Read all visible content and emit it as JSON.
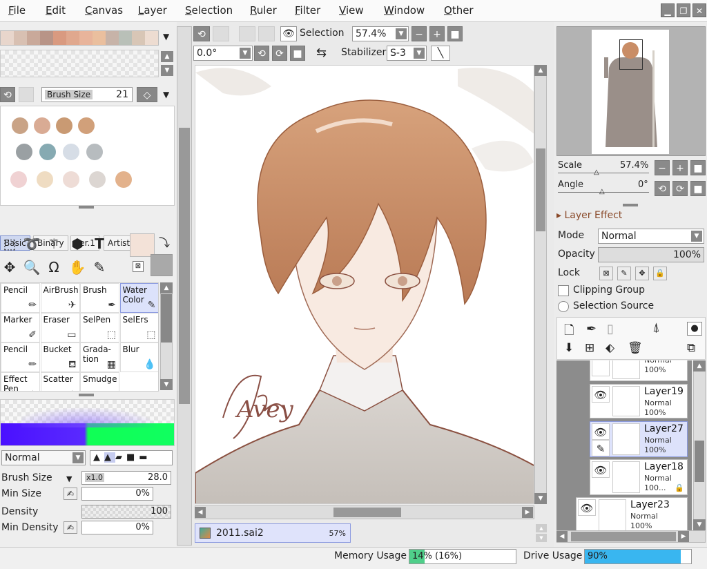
{
  "menu": {
    "items": [
      "File",
      "Edit",
      "Canvas",
      "Layer",
      "Selection",
      "Ruler",
      "Filter",
      "View",
      "Window",
      "Other"
    ]
  },
  "window_buttons": {
    "minimize": "▁",
    "restore": "❐",
    "close": "✕"
  },
  "brush_size_field": {
    "label": "Brush Size",
    "value": "21"
  },
  "swatch_colors": [
    "#c9a386",
    "#d9ab94",
    "#c99a73",
    "#d1a07a",
    "#9aa0a3",
    "#86aab2",
    "#d6dde6",
    "#b7bcbf",
    "#f0d2d3",
    "#efdcc2",
    "#eedcd6",
    "#dcd6d2",
    "#e3b28c"
  ],
  "palette_strip": [
    "#e8d6cc",
    "#d8c0b2",
    "#c9a99a",
    "#b89487",
    "#d99a80",
    "#e0a88e",
    "#e8b49b",
    "#eabf9e",
    "#c7b3a8",
    "#b9c0b8",
    "#d8c6b6",
    "#eddcd1"
  ],
  "tabs": [
    "Basic",
    "Binary",
    "Ver.1",
    "Artistic"
  ],
  "colors": {
    "fg": "#f3e2d8",
    "bg": "#a9a9a9",
    "accent": "#7b8fd0"
  },
  "brushes": [
    {
      "label": "Pencil"
    },
    {
      "label": "AirBrush"
    },
    {
      "label": "Brush"
    },
    {
      "label": "Water Color"
    },
    {
      "label": "Marker"
    },
    {
      "label": "Eraser"
    },
    {
      "label": "SelPen"
    },
    {
      "label": "SelErs"
    },
    {
      "label": "Pencil"
    },
    {
      "label": "Bucket"
    },
    {
      "label": "Grada- tion"
    },
    {
      "label": "Blur"
    },
    {
      "label": "Effect Pen"
    },
    {
      "label": "Scatter"
    },
    {
      "label": "Smudge"
    }
  ],
  "blend_mode": "Normal",
  "brush_settings": {
    "brush_size_label": "Brush Size",
    "brush_size_mult": "x1.0",
    "brush_size_value": "28.0",
    "min_size_label": "Min Size",
    "min_size_value": "0%",
    "density_label": "Density",
    "density_value": "100",
    "min_density_label": "Min Density",
    "min_density_value": "0%"
  },
  "canvas_toolbar": {
    "selection_label": "Selection",
    "zoom": "57.4%",
    "angle": "0.0°",
    "stabilizer_label": "Stabilizer",
    "stabilizer": "S-3"
  },
  "canvas": {
    "signature": "Avey"
  },
  "document_tab": {
    "name": "2011.sai2",
    "zoom": "57%"
  },
  "navigator": {
    "scale_label": "Scale",
    "scale": "57.4%",
    "angle_label": "Angle",
    "angle": "0°"
  },
  "layer_effect": {
    "title": "Layer Effect",
    "mode_label": "Mode",
    "mode": "Normal",
    "opacity_label": "Opacity",
    "opacity": "100%",
    "lock_label": "Lock",
    "clipping_group": "Clipping Group",
    "selection_source": "Selection Source"
  },
  "layers": [
    {
      "name": "",
      "mode": "Normal",
      "opacity": "100%"
    },
    {
      "name": "Layer19",
      "mode": "Normal",
      "opacity": "100%"
    },
    {
      "name": "Layer27",
      "mode": "Normal",
      "opacity": "100%"
    },
    {
      "name": "Layer18",
      "mode": "Normal",
      "opacity": "100..."
    },
    {
      "name": "Layer23",
      "mode": "Normal",
      "opacity": "100%"
    }
  ],
  "status": {
    "memory_label": "Memory Usage",
    "memory_value": "14% (16%)",
    "memory_fraction": 0.14,
    "drive_label": "Drive Usage",
    "drive_value": "90%",
    "drive_fraction": 0.9
  }
}
